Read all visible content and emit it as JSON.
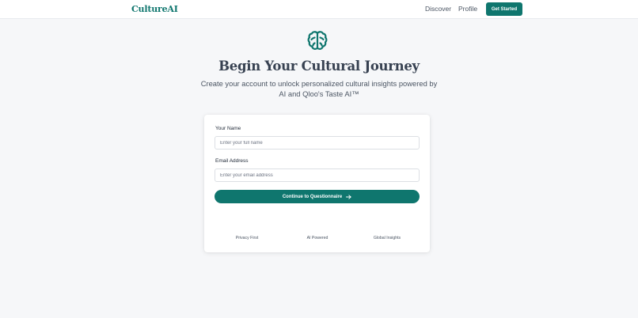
{
  "header": {
    "logo": "CultureAI",
    "nav": {
      "discover": "Discover",
      "profile": "Profile"
    },
    "cta": "Get Started"
  },
  "hero": {
    "icon": "brain-icon",
    "title": "Begin Your Cultural Journey",
    "subtitle": "Create your account to unlock personalized cultural insights powered by AI and Qloo's Taste AI™"
  },
  "form": {
    "name_label": "Your Name",
    "name_placeholder": "Enter your full name",
    "name_value": "",
    "email_label": "Email Address",
    "email_placeholder": "Enter your email address",
    "email_value": "",
    "submit_label": "Continue to Questionnaire"
  },
  "features": [
    "Privacy First",
    "AI Powered",
    "Global Insights"
  ],
  "colors": {
    "brand": "#0f766e",
    "background": "#f6f7f9",
    "card": "#ffffff"
  }
}
